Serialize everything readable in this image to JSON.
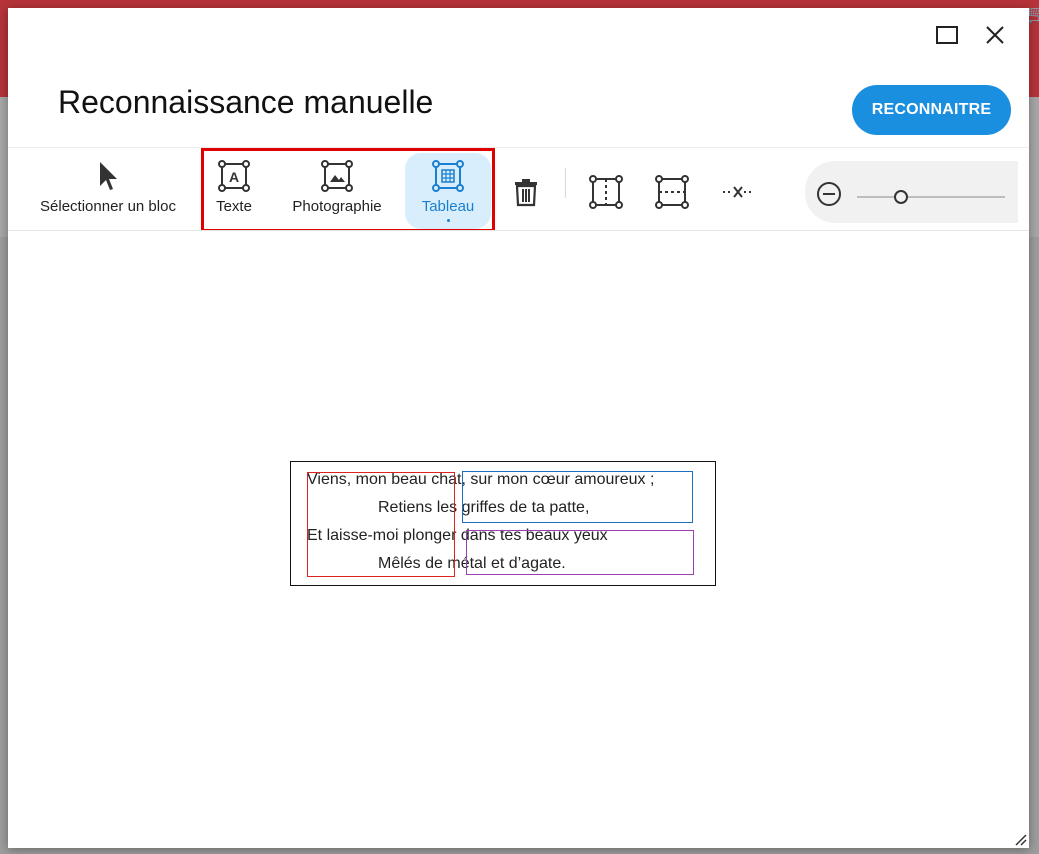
{
  "dialog": {
    "title": "Reconnaissance manuelle",
    "recognize_button": "RECONNAITRE",
    "accent_color": "#1a8fe0"
  },
  "toolbar": {
    "tools": [
      {
        "id": "select",
        "label": "Sélectionner un bloc",
        "icon": "cursor-arrow-icon"
      },
      {
        "id": "texte",
        "label": "Texte",
        "icon": "text-block-icon"
      },
      {
        "id": "photo",
        "label": "Photographie",
        "icon": "image-block-icon"
      },
      {
        "id": "tableau",
        "label": "Tableau",
        "icon": "table-block-icon",
        "selected": true
      }
    ],
    "actions": [
      "trash-icon",
      "split-vertical-icon",
      "split-horizontal-icon",
      "delete-separator-icon"
    ],
    "highlight_color": "#e00000"
  },
  "zoom": {
    "icon": "zoom-out-icon",
    "level": 0.3
  },
  "document": {
    "lines": [
      "Viens, mon beau chat, sur mon cœur amoureux ;",
      "Retiens les griffes de ta patte,",
      "Et laisse-moi plonger dans tes beaux yeux",
      "Mêlés de métal et d’agate."
    ],
    "block_colors": {
      "text": "#d22222",
      "table": "#1a6fc0",
      "picture": "#9b3fb5"
    }
  }
}
